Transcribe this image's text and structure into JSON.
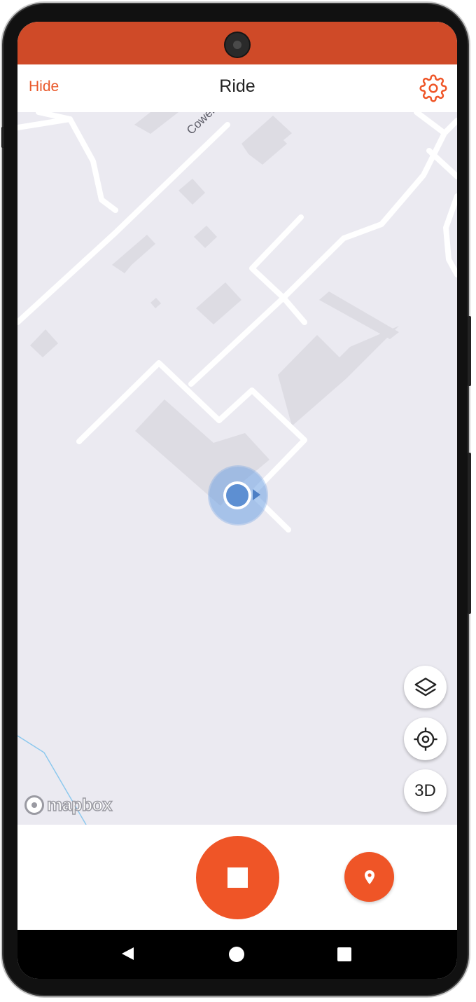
{
  "navbar": {
    "hide_label": "Hide",
    "title": "Ride",
    "settings_icon": "gear-icon"
  },
  "map": {
    "street_label": "Cowell S",
    "attribution": "mapbox",
    "controls": {
      "layers_icon": "layers-icon",
      "recenter_icon": "crosshair-icon",
      "view_3d_label": "3D"
    },
    "user_location_icon": "location-puck-icon"
  },
  "ride_controls": {
    "stop_icon": "stop-icon",
    "waypoint_icon": "map-pin-icon"
  },
  "system_nav": {
    "back_icon": "back-icon",
    "home_icon": "home-icon",
    "recents_icon": "recents-icon"
  },
  "colors": {
    "accent": "#ef5527",
    "status_bar": "#cf4a28",
    "map_background": "#ebeaf1",
    "location": "#5d8fd2"
  }
}
